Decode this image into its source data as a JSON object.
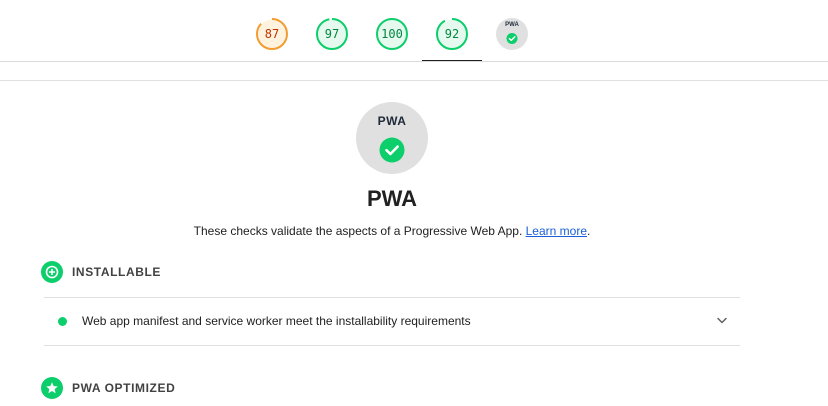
{
  "scores": [
    {
      "id": "performance",
      "value": "87",
      "color": "#f29c33",
      "text_color": "#c33300",
      "fraction": 0.87
    },
    {
      "id": "accessibility",
      "value": "97",
      "color": "#0cce6b",
      "text_color": "#018642",
      "fraction": 0.97
    },
    {
      "id": "best-practices",
      "value": "100",
      "color": "#0cce6b",
      "text_color": "#018642",
      "fraction": 1.0
    },
    {
      "id": "seo",
      "value": "92",
      "color": "#0cce6b",
      "text_color": "#018642",
      "fraction": 0.92
    }
  ],
  "pwa_tab": {
    "logo": "PWA",
    "icon": "check-icon"
  },
  "active_tab": "seo",
  "category": {
    "logo": "PWA",
    "title": "PWA",
    "description": "These checks validate the aspects of a Progressive Web App.",
    "learn_more": "Learn more",
    "period": "."
  },
  "groups": [
    {
      "title": "INSTALLABLE",
      "icon": "plus-icon"
    },
    {
      "title": "PWA OPTIMIZED",
      "icon": "star-icon"
    }
  ],
  "audits": [
    {
      "text": "Web app manifest and service worker meet the installability requirements",
      "status": "pass"
    }
  ],
  "colors": {
    "pass": "#0cce6b",
    "average": "#f29c33",
    "badge_bg": "#e0e0e0",
    "link": "#1a5fd6"
  }
}
